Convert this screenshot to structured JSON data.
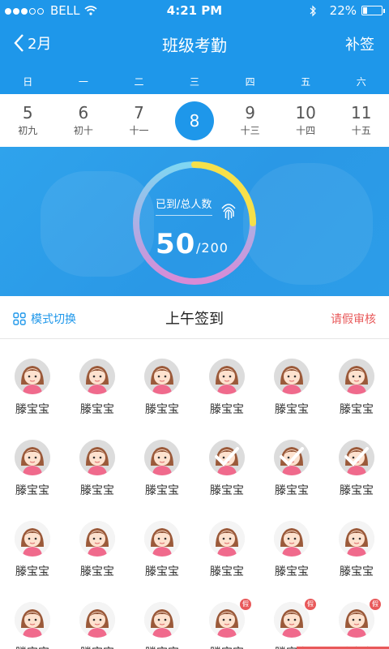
{
  "status_bar": {
    "carrier": "BELL",
    "time": "4:21 PM",
    "battery": "22%"
  },
  "nav": {
    "back_label": "2月",
    "title": "班级考勤",
    "action_label": "补签"
  },
  "weekdays": [
    "日",
    "一",
    "二",
    "三",
    "四",
    "五",
    "六"
  ],
  "days": [
    {
      "num": "5",
      "lunar": "初九"
    },
    {
      "num": "6",
      "lunar": "初十"
    },
    {
      "num": "7",
      "lunar": "十一"
    },
    {
      "num": "8",
      "lunar": "",
      "selected": true
    },
    {
      "num": "9",
      "lunar": "十三"
    },
    {
      "num": "10",
      "lunar": "十四"
    },
    {
      "num": "11",
      "lunar": "十五"
    }
  ],
  "attendance": {
    "label": "已到/总人数",
    "present": "50",
    "total": "/200",
    "ratio": 0.25
  },
  "toolbar": {
    "mode_label": "模式切换",
    "section_title": "上午签到",
    "leave_label": "请假审核"
  },
  "students": [
    {
      "name": "滕宝宝",
      "state": "absent"
    },
    {
      "name": "滕宝宝",
      "state": "absent"
    },
    {
      "name": "滕宝宝",
      "state": "absent"
    },
    {
      "name": "滕宝宝",
      "state": "absent"
    },
    {
      "name": "滕宝宝",
      "state": "absent"
    },
    {
      "name": "滕宝宝",
      "state": "absent"
    },
    {
      "name": "滕宝宝",
      "state": "absent"
    },
    {
      "name": "滕宝宝",
      "state": "absent"
    },
    {
      "name": "滕宝宝",
      "state": "absent"
    },
    {
      "name": "滕宝宝",
      "state": "checked"
    },
    {
      "name": "滕宝宝",
      "state": "checked"
    },
    {
      "name": "滕宝宝",
      "state": "checked"
    },
    {
      "name": "滕宝宝",
      "state": "present"
    },
    {
      "name": "滕宝宝",
      "state": "present"
    },
    {
      "name": "滕宝宝",
      "state": "present"
    },
    {
      "name": "滕宝宝",
      "state": "present"
    },
    {
      "name": "滕宝宝",
      "state": "present"
    },
    {
      "name": "滕宝宝",
      "state": "present"
    },
    {
      "name": "滕宝宝",
      "state": "present"
    },
    {
      "name": "滕宝宝",
      "state": "present"
    },
    {
      "name": "滕宝宝",
      "state": "present"
    },
    {
      "name": "滕宝宝",
      "state": "leave",
      "badge": "假"
    },
    {
      "name": "滕宝宝",
      "state": "leave",
      "badge": "假"
    },
    {
      "name": "滕宝宝",
      "state": "leave",
      "badge": "假"
    }
  ],
  "colors": {
    "primary": "#1e97ea",
    "danger": "#e8595a"
  }
}
